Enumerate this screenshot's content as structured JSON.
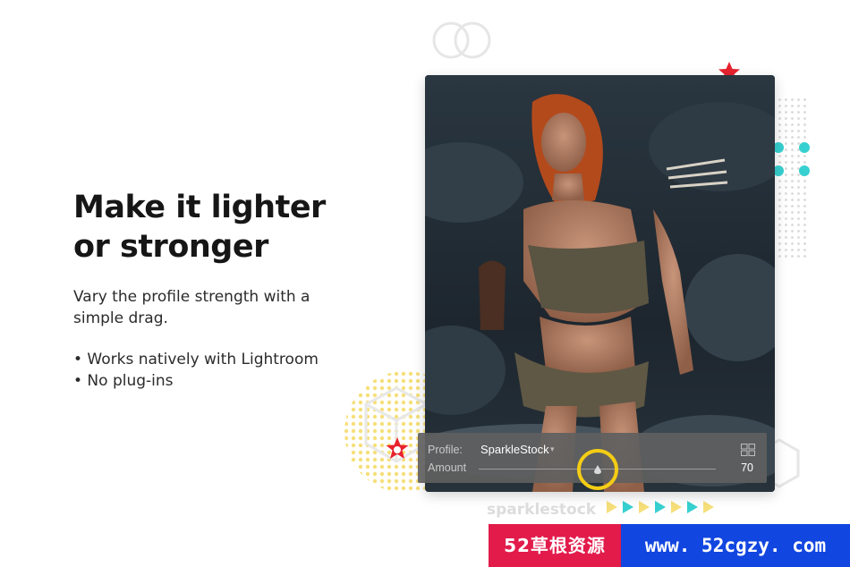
{
  "headline": {
    "line1": "Make it lighter",
    "line2": "or stronger"
  },
  "description": {
    "line1": "Vary the profile strength with a",
    "line2": "simple drag."
  },
  "bullets": [
    "• Works natively with Lightroom",
    "• No plug-ins"
  ],
  "profile_panel": {
    "profile_label": "Profile:",
    "profile_value": "SparkleStock",
    "amount_label": "Amount",
    "amount_value": "70",
    "amount_fraction": 0.5
  },
  "brand": {
    "wordmark": "sparklestock"
  },
  "watermark": {
    "left_text": "52草根资源",
    "right_text": "www. 52cgzy. com"
  },
  "colors": {
    "accent_yellow": "#f4cd15",
    "accent_teal": "#37d0d0",
    "accent_red": "#e8222e",
    "watermark_red": "#e21b4b",
    "watermark_blue": "#1146e0"
  },
  "icons": [
    "star-icon",
    "grid-view-icon",
    "slider-thumb-icon",
    "chevron-down-icon"
  ]
}
